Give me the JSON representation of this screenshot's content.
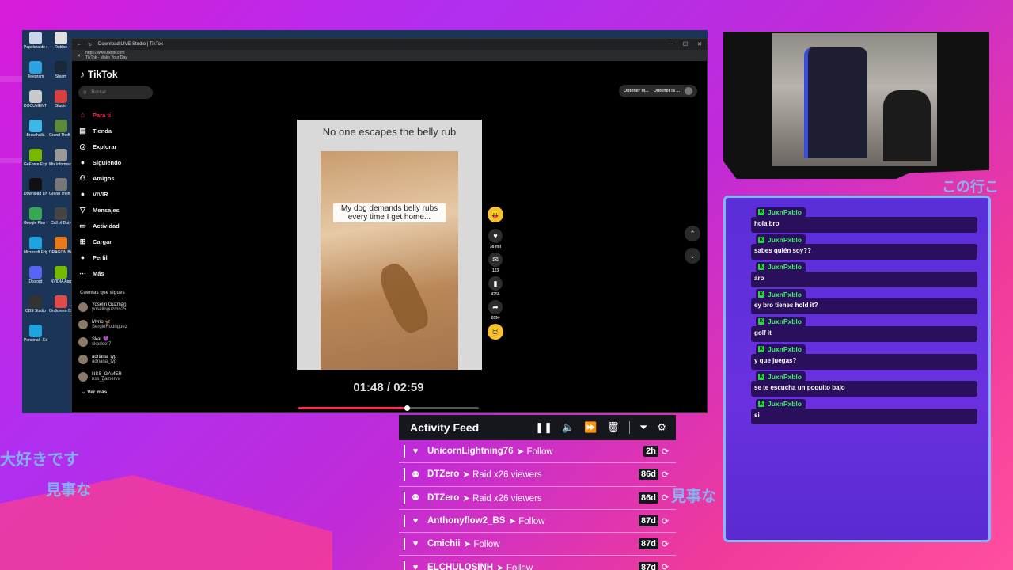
{
  "desktop": {
    "icons": [
      {
        "label": "Papelera de reciclaje",
        "color": "#c9d6e8"
      },
      {
        "label": "Roblox",
        "color": "#e0e0e0"
      },
      {
        "label": "Telegram",
        "color": "#2aa3e0"
      },
      {
        "label": "Steam",
        "color": "#1b2838"
      },
      {
        "label": "DOCUMENTOS",
        "color": "#c9c9c9"
      },
      {
        "label": "Studio",
        "color": "#d84040"
      },
      {
        "label": "Brawlhalla",
        "color": "#3cb8e8"
      },
      {
        "label": "Grand Theft Auto V",
        "color": "#5a8a3a"
      },
      {
        "label": "GeForce Experience",
        "color": "#76b900"
      },
      {
        "label": "Mis informaciones",
        "color": "#999999"
      },
      {
        "label": "Download LIVE Studio",
        "color": "#111111"
      },
      {
        "label": "Grand Theft Auto IV",
        "color": "#777777"
      },
      {
        "label": "Google Play Games beta",
        "color": "#34a853"
      },
      {
        "label": "Call of Duty",
        "color": "#444444"
      },
      {
        "label": "Microsoft Edge",
        "color": "#1fa3e0"
      },
      {
        "label": "DRAGON BALL",
        "color": "#e87a1e"
      },
      {
        "label": "Discord",
        "color": "#5865f2"
      },
      {
        "label": "NVIDIA App",
        "color": "#76b900"
      },
      {
        "label": "OBS Studio",
        "color": "#333333"
      },
      {
        "label": "OnScreen Control",
        "color": "#e04a4a"
      },
      {
        "label": "Personal - Edge",
        "color": "#1fa3e0"
      }
    ]
  },
  "browser": {
    "tab_title": "Download LIVE Studio | TikTok",
    "url": "https://www.tiktok.com",
    "page_title": "TikTok - Make Your Day"
  },
  "tiktok": {
    "logo": "TikTok",
    "search_placeholder": "Buscar",
    "nav": [
      {
        "label": "Para ti",
        "icon": "home-icon",
        "glyph": "⌂"
      },
      {
        "label": "Tienda",
        "icon": "shop-icon",
        "glyph": "▤"
      },
      {
        "label": "Explorar",
        "icon": "compass-icon",
        "glyph": "◎"
      },
      {
        "label": "Siguiendo",
        "icon": "following-icon",
        "glyph": "●"
      },
      {
        "label": "Amigos",
        "icon": "friends-icon",
        "glyph": "⚇"
      },
      {
        "label": "VIVIR",
        "icon": "live-icon",
        "glyph": "●"
      },
      {
        "label": "Mensajes",
        "icon": "messages-icon",
        "glyph": "▽"
      },
      {
        "label": "Actividad",
        "icon": "activity-icon",
        "glyph": "▭"
      },
      {
        "label": "Cargar",
        "icon": "upload-icon",
        "glyph": "⊞"
      },
      {
        "label": "Perfil",
        "icon": "profile-icon",
        "glyph": "●"
      },
      {
        "label": "Más",
        "icon": "more-icon",
        "glyph": "⋯"
      }
    ],
    "following_heading": "Cuentas que sigues",
    "accounts": [
      {
        "name": "Yoselin Guzmán",
        "handle": "yoselinguzmn25"
      },
      {
        "name": "Mvrio 🦋",
        "handle": "SergieRodriguez"
      },
      {
        "name": "Skar 💜",
        "handle": "skarleef7"
      },
      {
        "name": "adriana_typ",
        "handle": "adriana_typ"
      },
      {
        "name": "NSS_GAMER",
        "handle": "nss_gamervx"
      }
    ],
    "see_more": "Ver más",
    "top_actions": [
      "Obtener M...",
      "Obtener la ..."
    ]
  },
  "video": {
    "top_text": "No one escapes the belly rub",
    "overlay_text": "My dog demands belly rubs every time I get home...",
    "time": "01:48 / 02:59",
    "progress": 0.6,
    "actions": [
      {
        "icon": "heart-icon",
        "glyph": "♥",
        "count": "38 mil"
      },
      {
        "icon": "comment-icon",
        "glyph": "✉",
        "count": "123"
      },
      {
        "icon": "bookmark-icon",
        "glyph": "▮",
        "count": "4256"
      },
      {
        "icon": "share-icon",
        "glyph": "➦",
        "count": "2694"
      }
    ]
  },
  "chat": {
    "messages": [
      {
        "user": "JuxnPxblo",
        "text": "hola bro"
      },
      {
        "user": "JuxnPxblo",
        "text": "sabes quién soy??"
      },
      {
        "user": "JuxnPxblo",
        "text": "aro"
      },
      {
        "user": "JuxnPxblo",
        "text": "ey bro tienes hold it?"
      },
      {
        "user": "JuxnPxblo",
        "text": "golf it"
      },
      {
        "user": "JuxnPxblo",
        "text": "y que juegas?"
      },
      {
        "user": "JuxnPxblo",
        "text": "se te escucha un poquito bajo"
      },
      {
        "user": "JuxnPxblo",
        "text": "si"
      }
    ]
  },
  "feed": {
    "title": "Activity Feed",
    "rows": [
      {
        "icon": "heart-icon",
        "glyph": "♥",
        "name": "UnicornLightning76",
        "action": "Follow",
        "time": "2h"
      },
      {
        "icon": "raid-icon",
        "glyph": "⚉",
        "name": "DTZero",
        "action": "Raid x26 viewers",
        "time": "86d"
      },
      {
        "icon": "raid-icon",
        "glyph": "⚉",
        "name": "DTZero",
        "action": "Raid x26 viewers",
        "time": "86d"
      },
      {
        "icon": "heart-icon",
        "glyph": "♥",
        "name": "Anthonyflow2_BS",
        "action": "Follow",
        "time": "87d"
      },
      {
        "icon": "heart-icon",
        "glyph": "♥",
        "name": "Cmichii",
        "action": "Follow",
        "time": "87d"
      },
      {
        "icon": "heart-icon",
        "glyph": "♥",
        "name": "ELCHULOSINH",
        "action": "Follow",
        "time": "87d"
      }
    ]
  },
  "overlay_text": {
    "jp1": "大好きです",
    "jp2": "見事な",
    "jp3": "見事な",
    "jp4": "この行こ"
  }
}
